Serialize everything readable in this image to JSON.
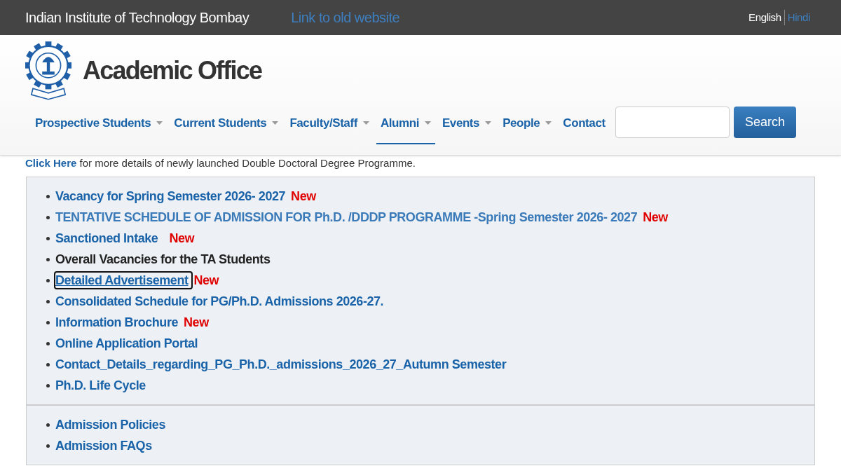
{
  "top_bar": {
    "institute": "Indian Institute of Technology Bombay",
    "old_site_link": "Link to old website",
    "languages": [
      {
        "label": "English",
        "selected": true
      },
      {
        "label": "Hindi",
        "selected": false
      }
    ]
  },
  "header": {
    "title": "Academic Office"
  },
  "nav": [
    {
      "label": "Prospective Students",
      "has_dropdown": true,
      "selected": false
    },
    {
      "label": "Current Students",
      "has_dropdown": true,
      "selected": false
    },
    {
      "label": "Faculty/Staff",
      "has_dropdown": true,
      "selected": false
    },
    {
      "label": "Alumni",
      "has_dropdown": true,
      "selected": true
    },
    {
      "label": "Events",
      "has_dropdown": true,
      "selected": false
    },
    {
      "label": "People",
      "has_dropdown": true,
      "selected": false
    },
    {
      "label": "Contact",
      "has_dropdown": false,
      "selected": false
    }
  ],
  "search": {
    "button": "Search"
  },
  "notice": {
    "link": "Click Here",
    "text": "for more details of newly launched Double Doctoral Degree Programme."
  },
  "sections": [
    {
      "items": [
        {
          "kind": "link",
          "label": "Vacancy for Spring Semester 2026- 2027",
          "badge": "New",
          "focused": false
        },
        {
          "kind": "light-link",
          "label": "TENTATIVE SCHEDULE OF ADMISSION FOR Ph.D. /DDDP PROGRAMME -Spring Semester 2026- 2027",
          "badge": "New",
          "focused": false
        },
        {
          "kind": "link",
          "label": "Sanctioned Intake",
          "badge": "New",
          "focused": false
        },
        {
          "kind": "text",
          "label": "Overall Vacancies for the TA Students",
          "focused": false
        },
        {
          "kind": "link",
          "label": "Detailed Advertisement",
          "badge": "New",
          "focused": true
        },
        {
          "kind": "link",
          "label": "Consolidated Schedule for PG/Ph.D. Admissions 2026-27.",
          "focused": false
        },
        {
          "kind": "link",
          "label": "Information Brochure",
          "badge": "New",
          "focused": false
        },
        {
          "kind": "link",
          "label": "Online Application Portal",
          "focused": false
        },
        {
          "kind": "link",
          "label": "Contact_Details_regarding_PG_Ph.D._admissions_2026_27_Autumn Semester",
          "focused": false
        },
        {
          "kind": "link",
          "label": "Ph.D. Life Cycle",
          "focused": false
        }
      ]
    },
    {
      "items": [
        {
          "kind": "link",
          "label": "Admission Policies",
          "focused": false
        },
        {
          "kind": "link",
          "label": "Admission FAQs",
          "focused": false
        }
      ]
    }
  ]
}
